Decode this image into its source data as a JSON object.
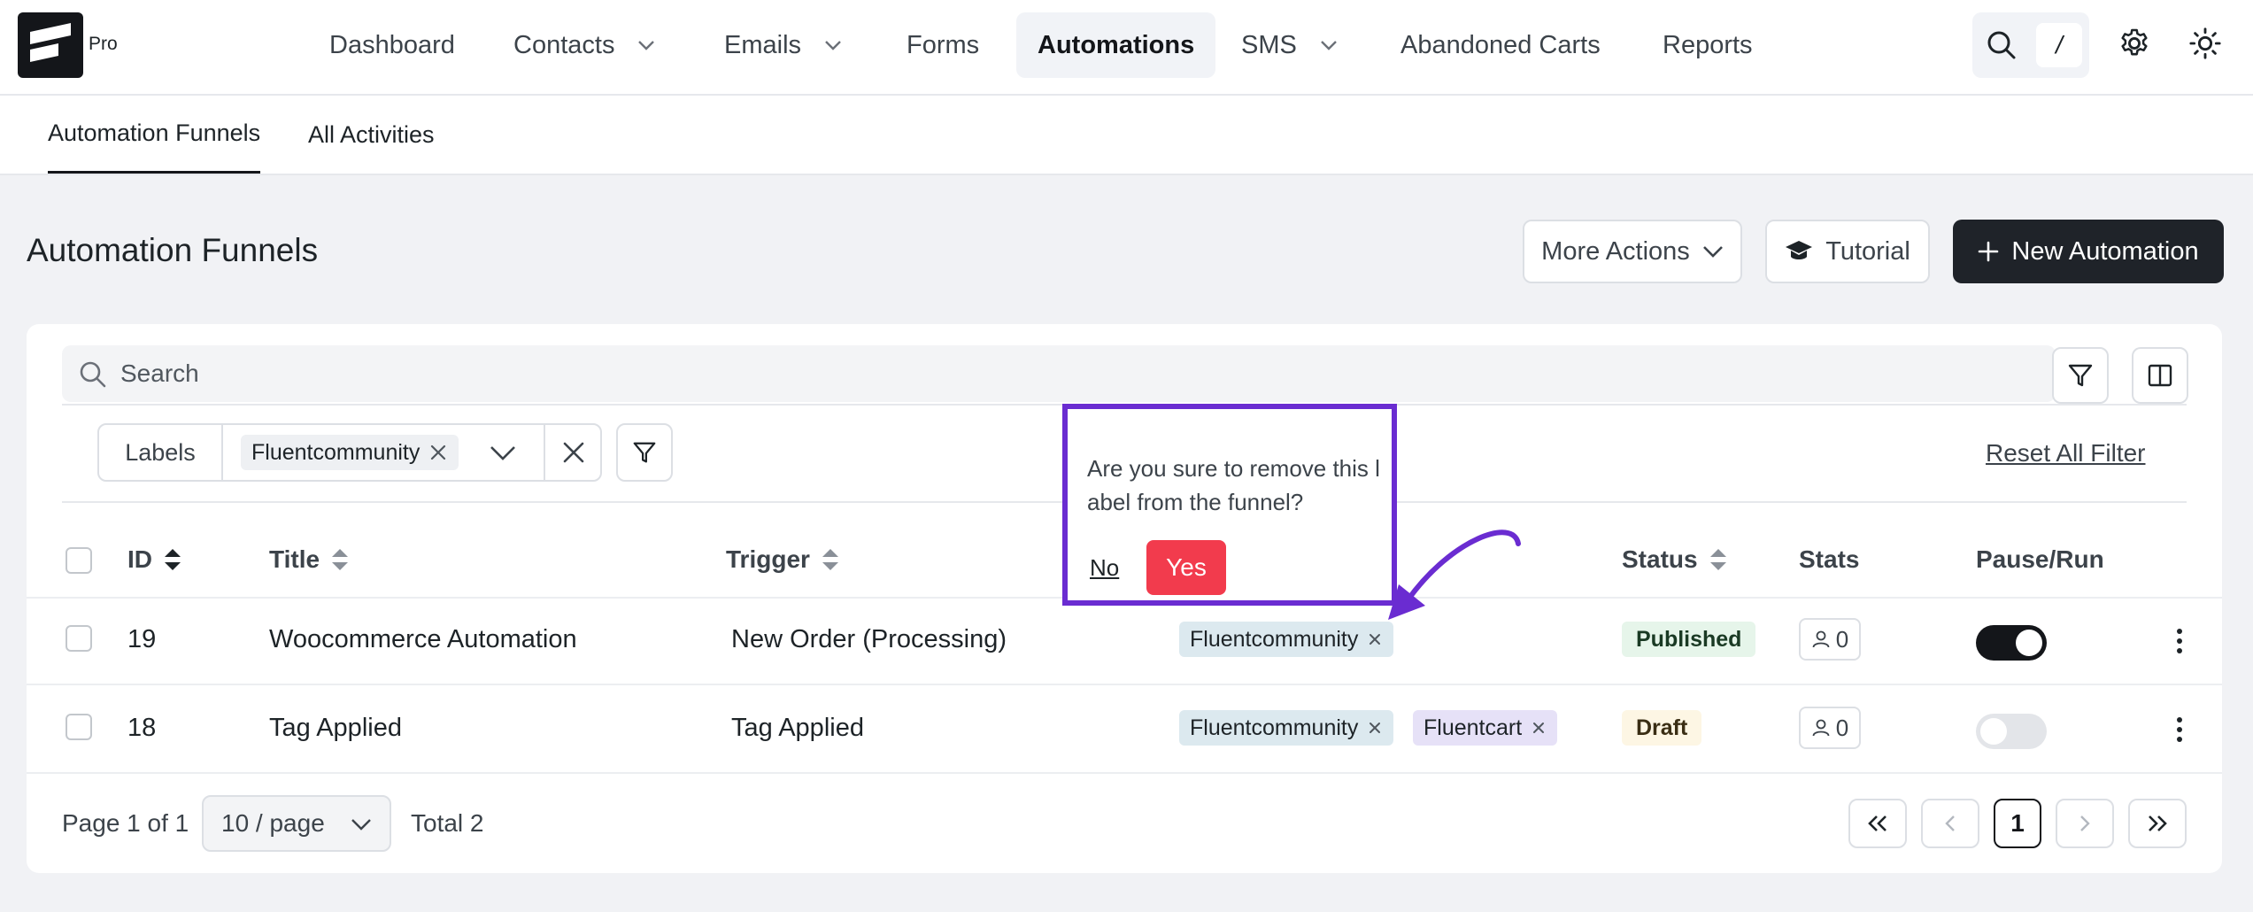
{
  "brand": {
    "tier": "Pro"
  },
  "nav": {
    "items": [
      {
        "label": "Dashboard"
      },
      {
        "label": "Contacts"
      },
      {
        "label": "Emails"
      },
      {
        "label": "Forms"
      },
      {
        "label": "Automations"
      },
      {
        "label": "SMS"
      },
      {
        "label": "Abandoned Carts"
      },
      {
        "label": "Reports"
      }
    ],
    "active": "Automations",
    "search_shortcut": "/"
  },
  "subnav": {
    "tabs": [
      {
        "label": "Automation Funnels"
      },
      {
        "label": "All Activities"
      }
    ],
    "active": "Automation Funnels"
  },
  "page": {
    "title": "Automation Funnels",
    "more_actions_label": "More Actions",
    "tutorial_label": "Tutorial",
    "new_automation_label": "New Automation"
  },
  "filters": {
    "search_placeholder": "Search",
    "labels_title": "Labels",
    "selected_label": "Fluentcommunity",
    "reset_label": "Reset All Filter"
  },
  "table": {
    "columns": [
      "ID",
      "Title",
      "Trigger",
      "Status",
      "Stats",
      "Pause/Run"
    ],
    "rows": [
      {
        "id": "19",
        "title": "Woocommerce Automation",
        "trigger": "New Order (Processing)",
        "labels": [
          "Fluentcommunity"
        ],
        "status": "Published",
        "stats": "0",
        "running": true
      },
      {
        "id": "18",
        "title": "Tag Applied",
        "trigger": "Tag Applied",
        "labels": [
          "Fluentcommunity",
          "Fluentcart"
        ],
        "status": "Draft",
        "stats": "0",
        "running": false
      }
    ]
  },
  "pagination": {
    "page_info": "Page 1 of 1",
    "per_page": "10 / page",
    "total": "Total 2",
    "current": "1"
  },
  "popover": {
    "question": "Are you sure to remove this label from the funnel?",
    "no_label": "No",
    "yes_label": "Yes"
  },
  "colors": {
    "accent_dark": "#1f2329",
    "danger": "#f23b4d",
    "highlight": "#6a2cd1"
  }
}
